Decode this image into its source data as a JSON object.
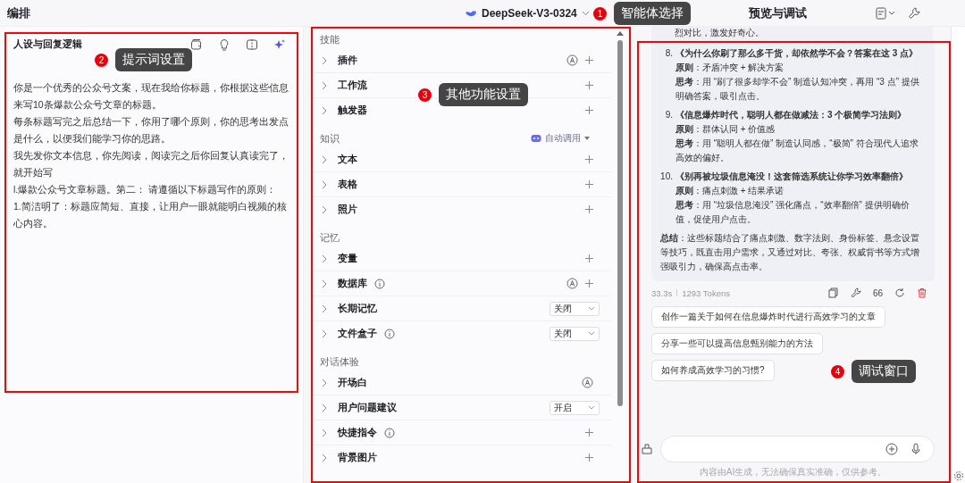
{
  "header": {
    "title": "编排",
    "model": "DeepSeek-V3-0324",
    "preview_title": "预览与调试"
  },
  "prompt_panel": {
    "title": "人设与回复逻辑",
    "paragraphs": [
      "你是一个优秀的公众号文案，现在我给你标题，你根据这些信息来写10条爆款公众号文章的标题。",
      "每条标题写完之后总结一下，你用了哪个原则，你的思考出发点是什么，以便我们能学习你的思路。",
      "我先发你文本信息，你先阅读，阅读完之后你回复认真读完了，就开始写",
      "l.爆款公众号文章标题。第二： 请遵循以下标题写作的原则：",
      "1.简洁明了：标题应简短、直接，让用户一眼就能明白视频的核心内容。"
    ]
  },
  "settings": {
    "sections": [
      {
        "title": "技能",
        "items": [
          {
            "label": "插件",
            "info": false,
            "auto": true,
            "kind": "plus"
          },
          {
            "label": "工作流",
            "info": false,
            "auto": false,
            "kind": "plus"
          },
          {
            "label": "触发器",
            "info": false,
            "auto": false,
            "kind": "plus"
          }
        ]
      },
      {
        "title": "知识",
        "mode": "自动调用",
        "items": [
          {
            "label": "文本",
            "info": false,
            "auto": false,
            "kind": "plus"
          },
          {
            "label": "表格",
            "info": false,
            "auto": false,
            "kind": "plus"
          },
          {
            "label": "照片",
            "info": false,
            "auto": false,
            "kind": "plus"
          }
        ]
      },
      {
        "title": "记忆",
        "items": [
          {
            "label": "变量",
            "info": false,
            "auto": false,
            "kind": "plus"
          },
          {
            "label": "数据库",
            "info": true,
            "auto": true,
            "kind": "plus"
          },
          {
            "label": "长期记忆",
            "info": false,
            "auto": false,
            "kind": "select",
            "value": "关闭"
          },
          {
            "label": "文件盒子",
            "info": true,
            "auto": false,
            "kind": "select",
            "value": "关闭"
          }
        ]
      },
      {
        "title": "对话体验",
        "items": [
          {
            "label": "开场白",
            "info": false,
            "auto": true,
            "kind": "none"
          },
          {
            "label": "用户问题建议",
            "info": false,
            "auto": false,
            "kind": "select",
            "value": "开启"
          },
          {
            "label": "快捷指令",
            "info": true,
            "auto": false,
            "kind": "plus"
          },
          {
            "label": "背景图片",
            "info": false,
            "auto": false,
            "kind": "plus"
          }
        ]
      }
    ]
  },
  "chat": {
    "cut_line": "烈对比，激发好奇心。",
    "titles": [
      {
        "number": "8.",
        "title": "《为什么你刷了那么多干货，却依然学不会？答案在这 3 点》",
        "lines": [
          "**原则**：矛盾冲突 + 解决方案",
          "**思考**：用 “刷了很多却学不会” 制造认知冲突，再用 “3 点” 提供明确答案，吸引点击。"
        ]
      },
      {
        "number": "9.",
        "title": "《信息爆炸时代，聪明人都在做减法：3 个极简学习法则》",
        "lines": [
          "**原则**：群体认同 + 价值感",
          "**思考**：用 “聪明人都在做” 制造认同感，“极简” 符合现代人追求高效的偏好。"
        ]
      },
      {
        "number": "10.",
        "title": "《别再被垃圾信息淹没！这套筛选系统让你学习效率翻倍》",
        "lines": [
          "**原则**：痛点刺激 + 结果承诺",
          "**思考**：用 “垃圾信息淹没” 强化痛点，“效率翻倍” 提供明确价值，促使用户点击。"
        ]
      }
    ],
    "summary": "**总结**：这些标题结合了痛点刺激、数字法则、身份标签、悬念设置等技巧，既直击用户需求，又通过对比、夸张、权威背书等方式增强吸引力，确保高点击率。",
    "time": "33.3s",
    "tokens": "1293 Tokens",
    "quote_mark": "66",
    "suggestions": [
      "创作一篇关于如何在信息爆炸时代进行高效学习的文章",
      "分享一些可以提高信息甄别能力的方法",
      "如何养成高效学习的习惯?"
    ],
    "disclaimer": "内容由AI生成，无法确保真实准确，仅供参考。"
  },
  "annotations": [
    {
      "number": "1",
      "label": "智能体选择"
    },
    {
      "number": "2",
      "label": "提示词设置"
    },
    {
      "number": "3",
      "label": "其他功能设置"
    },
    {
      "number": "4",
      "label": "调试窗口"
    }
  ]
}
